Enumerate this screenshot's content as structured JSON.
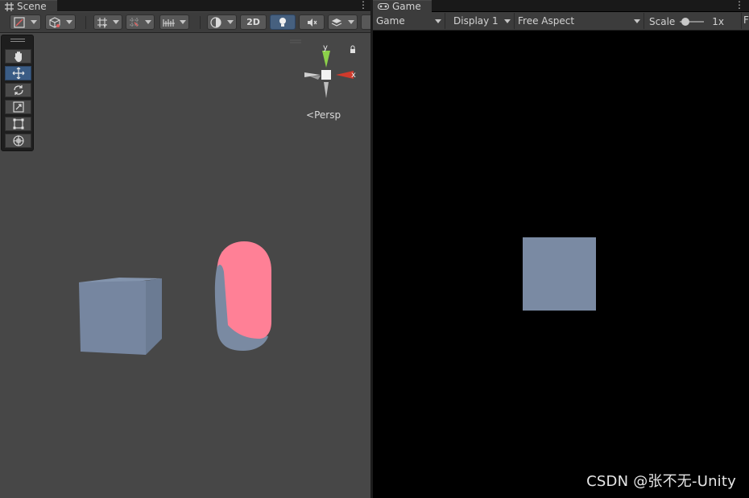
{
  "scene": {
    "tab_label": "Scene",
    "toggle_2d_label": "2D",
    "gizmo": {
      "y_label": "y",
      "x_label": "x"
    },
    "persp_label": "Persp"
  },
  "game": {
    "tab_label": "Game",
    "view_select": "Game",
    "display_select": "Display 1",
    "aspect_select": "Free Aspect",
    "scale_label": "Scale",
    "scale_value": "1x",
    "scale_level": 0.1
  },
  "watermark": "CSDN @张不无-Unity",
  "colors": {
    "viewport_bg": "#474747",
    "toolbar_bg": "#3c3c3c",
    "active_tool": "#3a5c85",
    "cube": "#7a8aa3",
    "capsule": "#ff8096",
    "game_bg": "#000000"
  },
  "icons": [
    "scene-tab-icon",
    "game-tab-icon",
    "hand-tool-icon",
    "move-tool-icon",
    "rotate-tool-icon",
    "scale-tool-icon",
    "rect-tool-icon",
    "transform-tool-icon",
    "lighting-toggle-icon",
    "lock-icon"
  ]
}
